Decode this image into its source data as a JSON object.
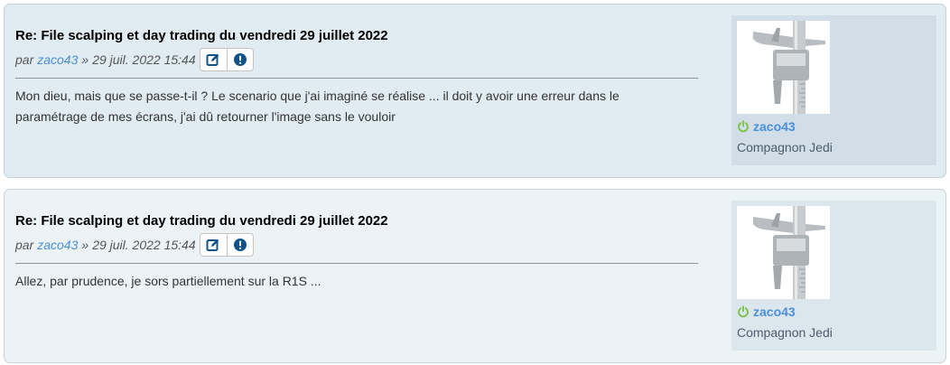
{
  "posts": [
    {
      "title": "Re: File scalping et day trading du vendredi 29 juillet 2022",
      "meta_prefix": "par",
      "author": "zaco43",
      "meta_sep": "»",
      "date": "29 juil. 2022 15:44",
      "content": "Mon dieu, mais que se passe-t-il ? Le scenario que j'ai imaginé se réalise ... il doit y avoir une erreur dans le paramétrage de mes écrans, j'ai dû retourner l'image sans le vouloir",
      "profile": {
        "username": "zaco43",
        "rank": "Compagnon Jedi",
        "online_icon": "power-icon"
      },
      "buttons": [
        {
          "icon": "edit-icon"
        },
        {
          "icon": "report-icon"
        }
      ]
    },
    {
      "title": "Re: File scalping et day trading du vendredi 29 juillet 2022",
      "meta_prefix": "par",
      "author": "zaco43",
      "meta_sep": "»",
      "date": "29 juil. 2022 15:44",
      "content": "Allez, par prudence, je sors partiellement sur la R1S ...",
      "profile": {
        "username": "zaco43",
        "rank": "Compagnon Jedi",
        "online_icon": "power-icon"
      },
      "buttons": [
        {
          "icon": "edit-icon"
        },
        {
          "icon": "report-icon"
        }
      ]
    }
  ],
  "colors": {
    "post_bg_1": "#e1ebf2",
    "post_bg_2": "#ecf3f7",
    "link": "#4a8fd8",
    "online": "#7ac142",
    "button_icon": "#105289"
  }
}
